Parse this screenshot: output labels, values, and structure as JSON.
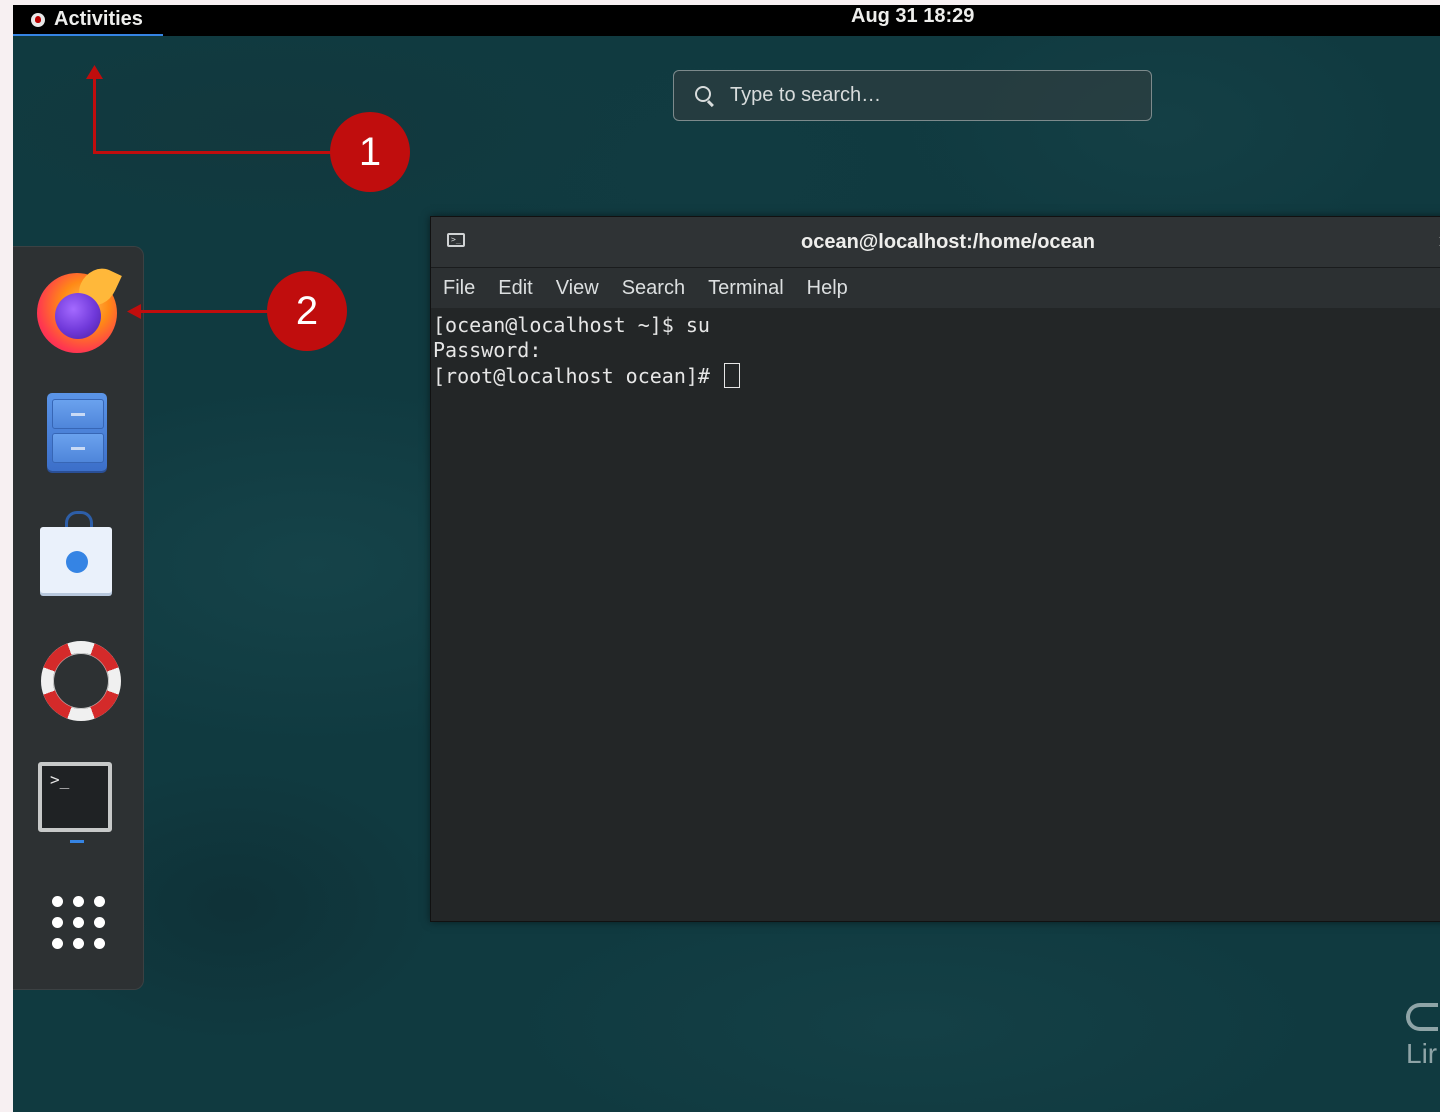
{
  "topbar": {
    "activities_label": "Activities",
    "clock": "Aug 31  18:29"
  },
  "search": {
    "placeholder": "Type to search…"
  },
  "dash": {
    "items": [
      {
        "icon": "firefox-icon"
      },
      {
        "icon": "files-icon"
      },
      {
        "icon": "software-icon"
      },
      {
        "icon": "help-icon"
      },
      {
        "icon": "terminal-icon",
        "running": true
      },
      {
        "icon": "show-applications-icon"
      }
    ]
  },
  "terminal_window": {
    "title": "ocean@localhost:/home/ocean",
    "close_glyph": "×",
    "icon_glyph": ">_",
    "menu": [
      "File",
      "Edit",
      "View",
      "Search",
      "Terminal",
      "Help"
    ],
    "lines": [
      "[ocean@localhost ~]$ su",
      "Password:",
      "[root@localhost ocean]# "
    ],
    "dash_icon_glyph": ">_"
  },
  "annotations": {
    "callout_1": "1",
    "callout_2": "2",
    "color": "#c00d0d"
  },
  "brand_partial": "Lir",
  "colors": {
    "topbar": "#000000",
    "accent": "#3584e4",
    "wallpaper": "#103a40",
    "terminal_bg": "#232627"
  }
}
